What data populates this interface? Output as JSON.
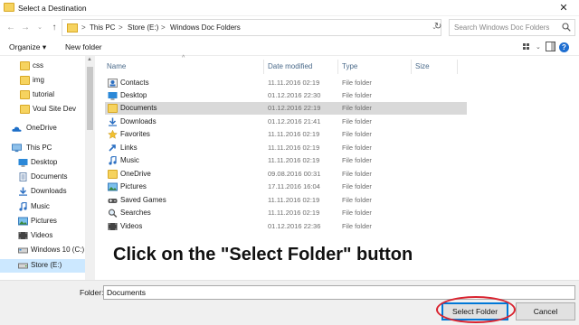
{
  "window": {
    "title": "Select a Destination",
    "close_glyph": "✕"
  },
  "address": {
    "back_glyph": "←",
    "forward_glyph": "→",
    "dropdown_glyph": "⌄",
    "up_glyph": "↑",
    "breadcrumb": [
      "This PC",
      "Store (E:)",
      "Windows Doc Folders"
    ],
    "separator": ">",
    "refresh_glyph": "↻",
    "search_placeholder": "Search Windows Doc Folders"
  },
  "toolbar": {
    "organize_label": "Organize ▾",
    "new_folder_label": "New folder",
    "help_glyph": "?"
  },
  "nav": {
    "items": [
      {
        "label": "css",
        "icon": "folder-icon",
        "indent": true
      },
      {
        "label": "img",
        "icon": "folder-icon",
        "indent": true
      },
      {
        "label": "tutorial",
        "icon": "folder-icon",
        "indent": true
      },
      {
        "label": "Voul Site Dev",
        "icon": "folder-icon",
        "indent": true
      },
      {
        "label": "OneDrive",
        "icon": "onedrive-icon",
        "indent": false
      },
      {
        "label": "This PC",
        "icon": "this-pc-icon",
        "indent": false
      },
      {
        "label": "Desktop",
        "icon": "desktop-icon",
        "indent": true
      },
      {
        "label": "Documents",
        "icon": "documents-icon",
        "indent": true
      },
      {
        "label": "Downloads",
        "icon": "downloads-icon",
        "indent": true
      },
      {
        "label": "Music",
        "icon": "music-icon",
        "indent": true
      },
      {
        "label": "Pictures",
        "icon": "pictures-icon",
        "indent": true
      },
      {
        "label": "Videos",
        "icon": "videos-icon",
        "indent": true
      },
      {
        "label": "Windows 10 (C:)",
        "icon": "drive-icon",
        "indent": true
      },
      {
        "label": "Store (E:)",
        "icon": "drive-icon",
        "indent": true,
        "selected": true
      }
    ]
  },
  "columns": {
    "name": "Name",
    "date": "Date modified",
    "type": "Type",
    "size": "Size"
  },
  "files": [
    {
      "name": "Contacts",
      "date": "11.11.2016 02:19",
      "type": "File folder",
      "icon": "contacts-icon"
    },
    {
      "name": "Desktop",
      "date": "01.12.2016 22:30",
      "type": "File folder",
      "icon": "desktop-icon"
    },
    {
      "name": "Documents",
      "date": "01.12.2016 22:19",
      "type": "File folder",
      "icon": "folder-icon",
      "selected": true
    },
    {
      "name": "Downloads",
      "date": "01.12.2016 21:41",
      "type": "File folder",
      "icon": "downloads-icon"
    },
    {
      "name": "Favorites",
      "date": "11.11.2016 02:19",
      "type": "File folder",
      "icon": "favorites-icon"
    },
    {
      "name": "Links",
      "date": "11.11.2016 02:19",
      "type": "File folder",
      "icon": "links-icon"
    },
    {
      "name": "Music",
      "date": "11.11.2016 02:19",
      "type": "File folder",
      "icon": "music-icon"
    },
    {
      "name": "OneDrive",
      "date": "09.08.2016 00:31",
      "type": "File folder",
      "icon": "folder-icon"
    },
    {
      "name": "Pictures",
      "date": "17.11.2016 16:04",
      "type": "File folder",
      "icon": "pictures-icon"
    },
    {
      "name": "Saved Games",
      "date": "11.11.2016 02:19",
      "type": "File folder",
      "icon": "saved-games-icon"
    },
    {
      "name": "Searches",
      "date": "11.11.2016 02:19",
      "type": "File folder",
      "icon": "searches-icon"
    },
    {
      "name": "Videos",
      "date": "01.12.2016 22:36",
      "type": "File folder",
      "icon": "videos-icon"
    }
  ],
  "overlay_text": "Click on the \"Select Folder\" button",
  "footer": {
    "folder_label": "Folder:",
    "folder_value": "Documents",
    "select_label": "Select Folder",
    "cancel_label": "Cancel"
  },
  "colors": {
    "accent": "#0078d7",
    "highlight_ring": "#d9232f",
    "folder_yellow": "#f6d35f",
    "nav_selected": "#cce8ff",
    "row_selected": "#d9d9d9"
  }
}
